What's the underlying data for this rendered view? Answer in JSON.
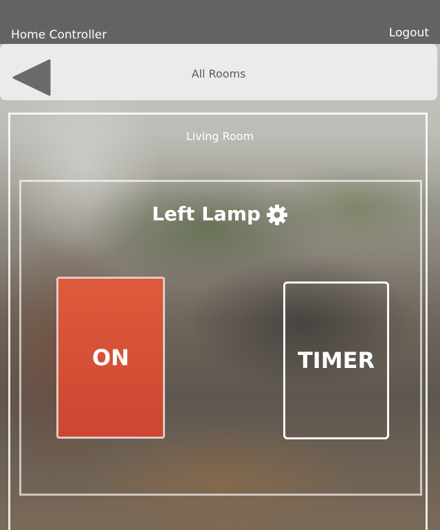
{
  "header": {
    "app_title": "Home Controller",
    "logout_label": "Logout"
  },
  "nav": {
    "title": "All Rooms",
    "back_icon": "back-arrow-icon"
  },
  "room": {
    "name": "Living Room"
  },
  "device": {
    "name": "Left Lamp",
    "settings_icon": "gear-icon",
    "on_label": "ON",
    "timer_label": "TIMER",
    "state": "on"
  },
  "colors": {
    "header_bg": "#636363",
    "on_button": "#d24e35",
    "nav_bg": "#eeeeee",
    "text_light": "#ffffff"
  }
}
